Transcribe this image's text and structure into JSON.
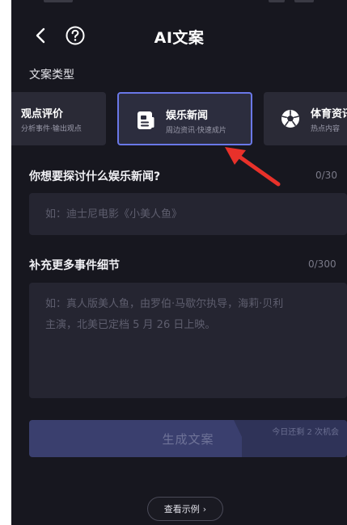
{
  "header": {
    "title": "AI文案"
  },
  "type_section": {
    "label": "文案类型",
    "cards": [
      {
        "title": "观点评价",
        "subtitle": "分析事件·输出观点"
      },
      {
        "title": "娱乐新闻",
        "subtitle": "周边资讯·快速成片",
        "selected": true
      },
      {
        "title": "体育资讯",
        "subtitle": "热点内容"
      }
    ]
  },
  "topic_field": {
    "label": "你想要探讨什么娱乐新闻?",
    "counter": "0/30",
    "placeholder": "如：迪士尼电影《小美人鱼》"
  },
  "detail_field": {
    "label": "补充更多事件细节",
    "counter": "0/300",
    "placeholder_line1": "如：真人版美人鱼，由罗伯·马歇尔执导，海莉·贝利",
    "placeholder_line2": "主演，北美已定档 5 月 26 日上映。"
  },
  "generate": {
    "label": "生成文案",
    "chances": "今日还剩 2 次机会"
  },
  "example": {
    "label": "查看示例"
  },
  "colors": {
    "background": "#17171f",
    "card": "#2a2a36",
    "accent_border": "#6a78e8",
    "annotation": "#e8312a",
    "button": "#3a3f6e"
  }
}
